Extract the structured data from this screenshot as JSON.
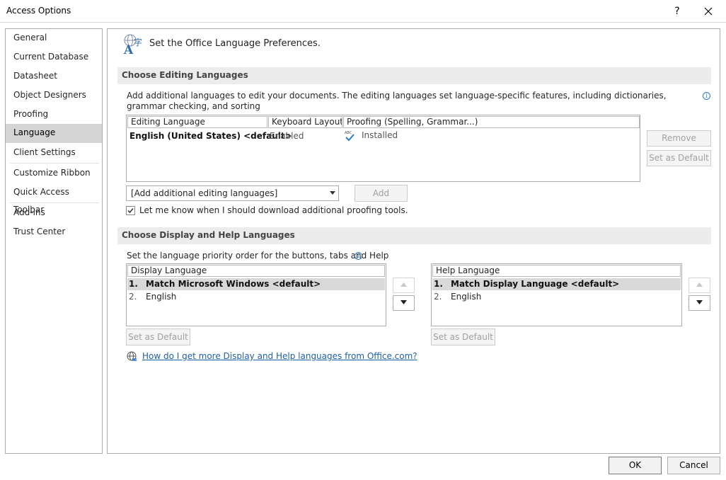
{
  "window": {
    "title": "Access Options",
    "help_glyph": "?",
    "close_glyph": "✕"
  },
  "sidebar": {
    "items": [
      {
        "label": "General"
      },
      {
        "label": "Current Database"
      },
      {
        "label": "Datasheet"
      },
      {
        "label": "Object Designers"
      },
      {
        "label": "Proofing"
      },
      {
        "label": "Language"
      },
      {
        "label": "Client Settings"
      },
      {
        "label": "Customize Ribbon"
      },
      {
        "label": "Quick Access Toolbar"
      },
      {
        "label": "Add-ins"
      },
      {
        "label": "Trust Center"
      }
    ],
    "selected": "Language"
  },
  "main": {
    "heading": "Set the Office Language Preferences.",
    "editing": {
      "section_title": "Choose Editing Languages",
      "description": "Add additional languages to edit your documents. The editing languages set language-specific features, including dictionaries, grammar checking, and sorting",
      "columns": [
        "Editing Language",
        "Keyboard Layout",
        "Proofing (Spelling, Grammar...)"
      ],
      "rows": [
        {
          "language": "English (United States) <default>",
          "keyboard": "Enabled",
          "proofing_badge": "ABC",
          "proofing": "Installed"
        }
      ],
      "remove_label": "Remove",
      "set_default_label": "Set as Default",
      "add_dropdown_value": "[Add additional editing languages]",
      "add_label": "Add",
      "notify_checkbox_label": "Let me know when I should download additional proofing tools.",
      "notify_checked": true
    },
    "display": {
      "section_title": "Choose Display and Help Languages",
      "description": "Set the language priority order for the buttons, tabs and Help",
      "display_list": {
        "header": "Display Language",
        "items": [
          {
            "num": "1.",
            "label": "Match Microsoft Windows <default>"
          },
          {
            "num": "2.",
            "label": "English"
          }
        ]
      },
      "help_list": {
        "header": "Help Language",
        "items": [
          {
            "num": "1.",
            "label": "Match Display Language <default>"
          },
          {
            "num": "2.",
            "label": "English"
          }
        ]
      },
      "set_default_label": "Set as Default",
      "link_text": "How do I get more Display and Help languages from Office.com?"
    }
  },
  "footer": {
    "ok_label": "OK",
    "cancel_label": "Cancel"
  },
  "colors": {
    "accent": "#2b7bd6",
    "selection": "#d4d4d4",
    "link": "#1f5fa8"
  }
}
